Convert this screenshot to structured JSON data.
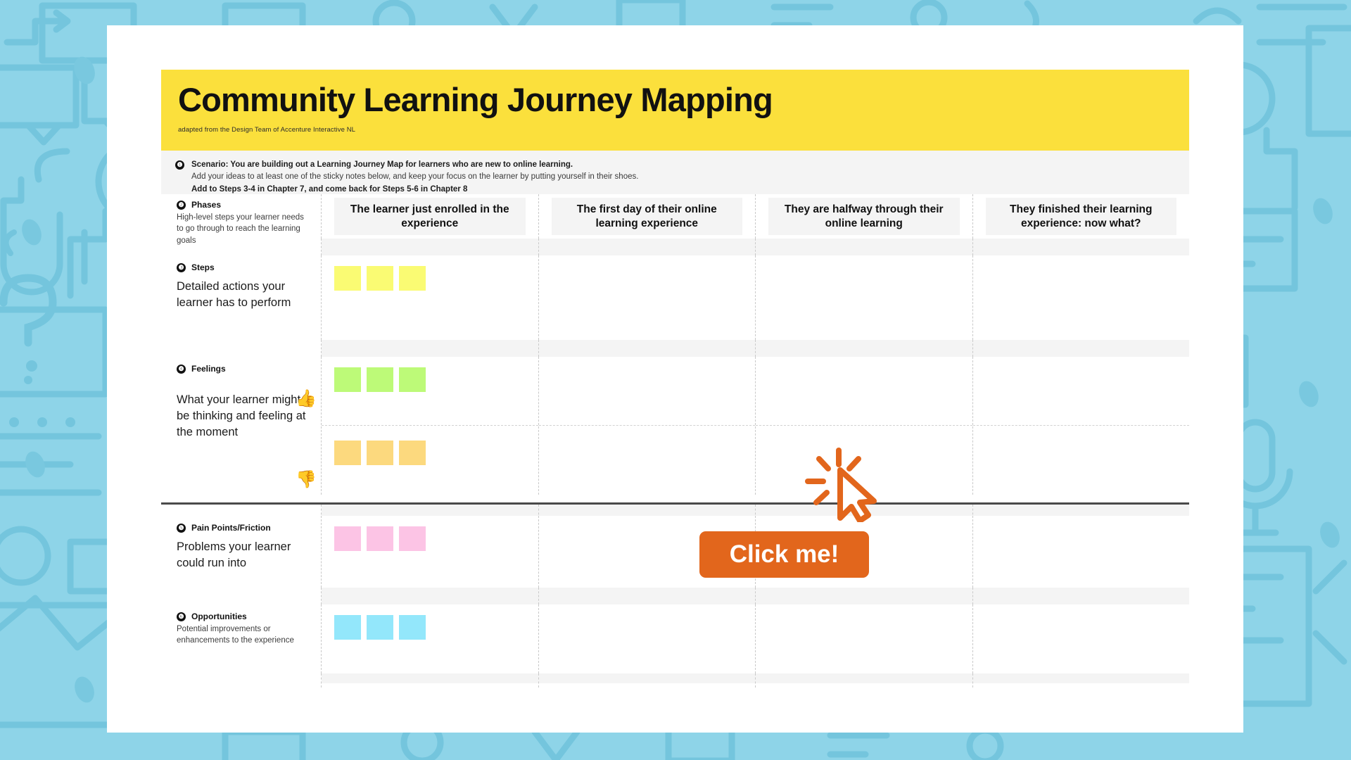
{
  "theme": {
    "background_color": "#8ed4e8",
    "title_band_color": "#fbe03c",
    "button_color": "#e2661c",
    "cursor_color": "#e2661c",
    "panel_color": "#ffffff",
    "strip_color": "#f4f4f4"
  },
  "header": {
    "title": "Community Learning Journey Mapping",
    "credit": "adapted from the Design Team of Accenture Interactive NL"
  },
  "scenario": {
    "number": "1",
    "line1_bold_lead": "Scenario",
    "line1_rest": ": You are building out a Learning Journey Map for learners who are new to online learning.",
    "line2": "Add your ideas to at least one of the sticky notes below, and keep your focus on the learner by putting yourself in their shoes.",
    "line3": "Add to Steps 3-4 in Chapter 7, and come back for Steps 5-6 in Chapter 8"
  },
  "phases": {
    "number": "2",
    "title": "Phases",
    "description": "High-level steps your learner needs to go through to reach the learning goals",
    "columns": [
      "The learner just enrolled in the experience",
      "The first day of their online learning experience",
      "They are halfway through their online learning",
      "They finished their learning experience: now what?"
    ]
  },
  "rows": [
    {
      "number": "3",
      "title": "Steps",
      "description": "Detailed actions your learner has to perform",
      "note_color": "#fafb73",
      "note_count": 3
    },
    {
      "number": "4",
      "title": "Feelings",
      "description": "What your learner might be thinking and feeling at the moment",
      "note_color_positive": "#bdfa78",
      "note_color_negative": "#fcd97e",
      "note_count": 3,
      "icon_positive": "thumbs-up-icon",
      "icon_negative": "thumbs-down-icon"
    },
    {
      "number": "5",
      "title": "Pain Points/Friction",
      "description": "Problems your learner could run into",
      "note_color": "#fcc4e5",
      "note_count": 3
    },
    {
      "number": "6",
      "title": "Opportunities",
      "description": "Potential improvements or enhancements to the experience",
      "note_color": "#93e7fb",
      "note_count": 3
    }
  ],
  "cta": {
    "label": "Click me!",
    "cursor_icon": "click-cursor-icon"
  }
}
